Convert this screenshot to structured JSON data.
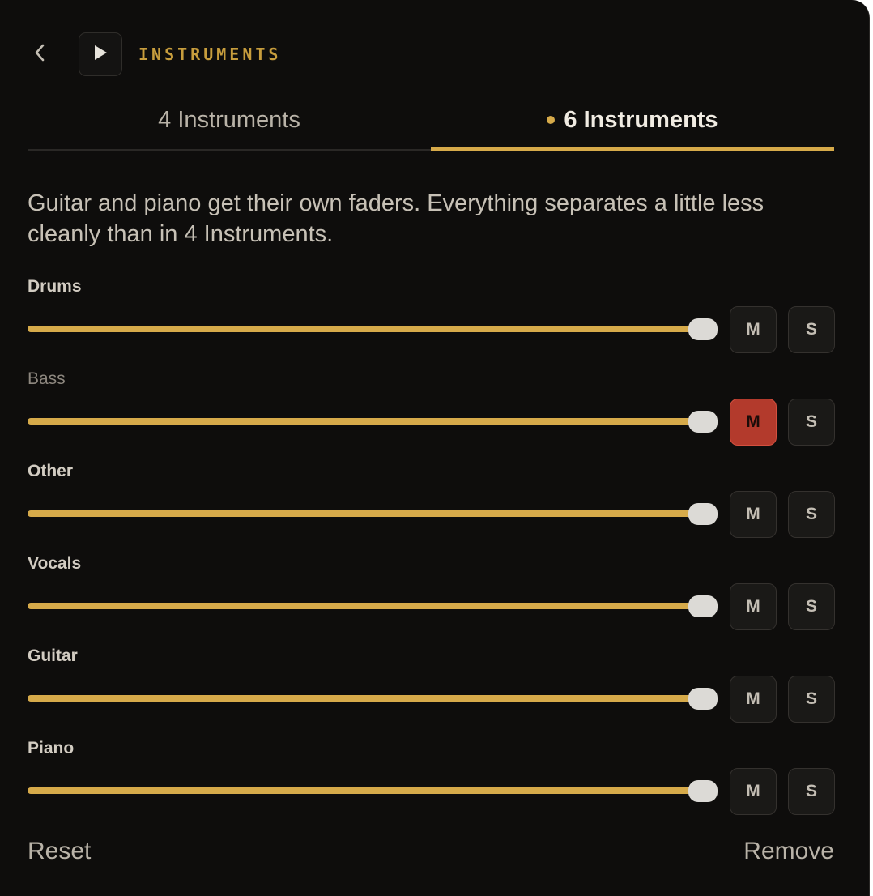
{
  "header": {
    "title": "INSTRUMENTS",
    "back_icon": "chevron-left-icon",
    "play_icon": "play-icon"
  },
  "tabs": [
    {
      "label": "4 Instruments",
      "active": false
    },
    {
      "label": "6 Instruments",
      "active": true
    }
  ],
  "description": "Guitar and piano get their own faders. Everything separates a little less cleanly than in 4 Instruments.",
  "tracks": [
    {
      "name": "Drums",
      "level": 1.0,
      "mute_label": "M",
      "solo_label": "S",
      "muted": false
    },
    {
      "name": "Bass",
      "level": 1.0,
      "mute_label": "M",
      "solo_label": "S",
      "muted": true
    },
    {
      "name": "Other",
      "level": 1.0,
      "mute_label": "M",
      "solo_label": "S",
      "muted": false
    },
    {
      "name": "Vocals",
      "level": 1.0,
      "mute_label": "M",
      "solo_label": "S",
      "muted": false
    },
    {
      "name": "Guitar",
      "level": 1.0,
      "mute_label": "M",
      "solo_label": "S",
      "muted": false
    },
    {
      "name": "Piano",
      "level": 1.0,
      "mute_label": "M",
      "solo_label": "S",
      "muted": false
    }
  ],
  "footer": {
    "reset_label": "Reset",
    "remove_label": "Remove"
  },
  "colors": {
    "accent": "#d6aa4a",
    "mute_active": "#b33a2c",
    "background": "#0e0d0c"
  }
}
